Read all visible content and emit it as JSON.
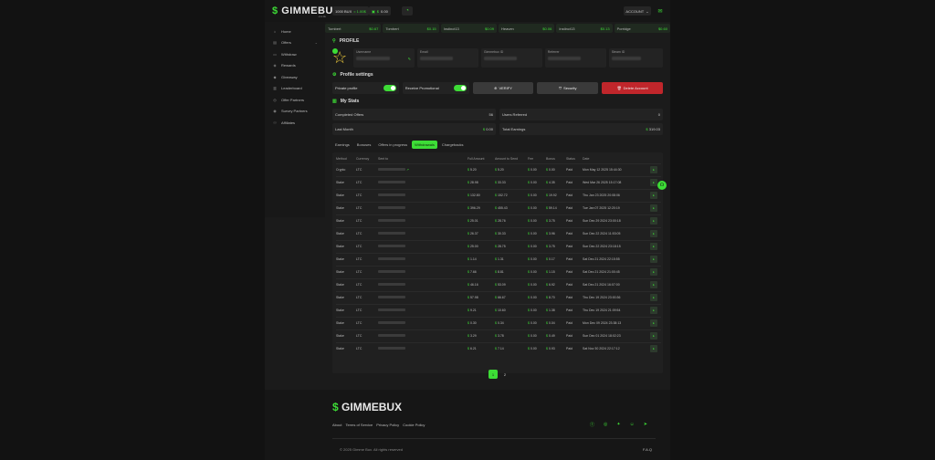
{
  "brand": {
    "name": "GIMMEBUX",
    "sub": ".com"
  },
  "topbar": {
    "balance_bux": "1000 BUX",
    "balance_eq": "= 1.00$",
    "wallet_amount": "0.00",
    "account_label": "ACCOUNT"
  },
  "ticker": [
    {
      "name": "Tombert",
      "value": "0.67"
    },
    {
      "name": "Tombert",
      "value": "0.15"
    },
    {
      "name": "Instinct13",
      "value": "0.09"
    },
    {
      "name": "Heaven",
      "value": "0.06"
    },
    {
      "name": "Instinct13",
      "value": "0.13"
    },
    {
      "name": "Porridge",
      "value": "0.60"
    }
  ],
  "sidebar": {
    "items": [
      {
        "label": "Home",
        "icon": "home-icon"
      },
      {
        "label": "Offers",
        "icon": "offers-icon"
      },
      {
        "label": "Withdraw",
        "icon": "withdraw-icon"
      },
      {
        "label": "Rewards",
        "icon": "rewards-icon"
      },
      {
        "label": "Giveaway",
        "icon": "giveaway-icon"
      },
      {
        "label": "Leaderboard",
        "icon": "leaderboard-icon"
      },
      {
        "label": "Offer Partners",
        "icon": "partners-icon"
      },
      {
        "label": "Survey Partners",
        "icon": "survey-icon"
      },
      {
        "label": "Affiliates",
        "icon": "affiliates-icon"
      }
    ]
  },
  "profile": {
    "title": "PROFILE",
    "fields": [
      {
        "label": "Username"
      },
      {
        "label": "Email"
      },
      {
        "label": "Gimmebux ID"
      },
      {
        "label": "Referrer"
      },
      {
        "label": "Steam ID"
      }
    ]
  },
  "settings": {
    "title": "Profile settings",
    "private_profile": "Private profile",
    "receive_promotional": "Receive Promotional",
    "verify": "VERIFY",
    "security": "Security",
    "delete": "Delete Account"
  },
  "stats": {
    "title": "My Stats",
    "completed_offers_label": "Completed Offers",
    "completed_offers_value": "56",
    "users_referred_label": "Users Referred",
    "users_referred_value": "0",
    "last_month_label": "Last Month",
    "last_month_value": "0.00",
    "total_earnings_label": "Total Earnings",
    "total_earnings_value": "319.03"
  },
  "tabs": [
    "Earnings",
    "Bonuses",
    "Offers in progress",
    "Withdrawals",
    "Chargebacks"
  ],
  "table": {
    "headers": [
      "Method",
      "Currency",
      "Sent to",
      "Full Amount",
      "Amount to Send",
      "Fee",
      "Bonus",
      "Status",
      "Date"
    ],
    "rows": [
      {
        "method": "Crypto",
        "currency": "LTC",
        "full": "5.20",
        "send": "5.20",
        "fee": "0.00",
        "bonus": "0.00",
        "status": "Paid",
        "date": "Mon May 12 2025 15:44:30"
      },
      {
        "method": "Stake",
        "currency": "LTC",
        "full": "28.98",
        "send": "33.33",
        "fee": "0.00",
        "bonus": "4.35",
        "status": "Paid",
        "date": "Wed Mar 26 2025 15:17:08"
      },
      {
        "method": "Stake",
        "currency": "LTC",
        "full": "132.80",
        "send": "152.72",
        "fee": "0.00",
        "bonus": "19.92",
        "status": "Paid",
        "date": "Thu Jan 23 2025 20:08:06"
      },
      {
        "method": "Stake",
        "currency": "LTC",
        "full": "396.29",
        "send": "455.43",
        "fee": "0.00",
        "bonus": "59.14",
        "status": "Paid",
        "date": "Tue Jan 07 2025 12:20:19"
      },
      {
        "method": "Stake",
        "currency": "LTC",
        "full": "25.01",
        "send": "28.76",
        "fee": "0.00",
        "bonus": "3.75",
        "status": "Paid",
        "date": "Sun Dec 29 2024 23:00:18"
      },
      {
        "method": "Stake",
        "currency": "LTC",
        "full": "26.37",
        "send": "30.33",
        "fee": "0.00",
        "bonus": "3.96",
        "status": "Paid",
        "date": "Sun Dec 22 2024 11:53:05"
      },
      {
        "method": "Stake",
        "currency": "LTC",
        "full": "25.00",
        "send": "28.75",
        "fee": "0.00",
        "bonus": "3.75",
        "status": "Paid",
        "date": "Sun Dec 22 2024 23:18:15"
      },
      {
        "method": "Stake",
        "currency": "LTC",
        "full": "1.14",
        "send": "1.31",
        "fee": "0.00",
        "bonus": "0.17",
        "status": "Paid",
        "date": "Sat Dec 21 2024 22:15:55"
      },
      {
        "method": "Stake",
        "currency": "LTC",
        "full": "7.66",
        "send": "8.81",
        "fee": "0.00",
        "bonus": "1.15",
        "status": "Paid",
        "date": "Sat Dec 21 2024 21:00:45"
      },
      {
        "method": "Stake",
        "currency": "LTC",
        "full": "46.16",
        "send": "53.09",
        "fee": "0.00",
        "bonus": "6.92",
        "status": "Paid",
        "date": "Sat Dec 21 2024 16:07:00"
      },
      {
        "method": "Stake",
        "currency": "LTC",
        "full": "57.98",
        "send": "66.67",
        "fee": "0.00",
        "bonus": "8.70",
        "status": "Paid",
        "date": "Thu Dec 19 2024 23:00:36"
      },
      {
        "method": "Stake",
        "currency": "LTC",
        "full": "9.21",
        "send": "10.60",
        "fee": "0.00",
        "bonus": "1.38",
        "status": "Paid",
        "date": "Thu Dec 19 2024 21:09:54"
      },
      {
        "method": "Stake",
        "currency": "LTC",
        "full": "0.30",
        "send": "0.34",
        "fee": "0.00",
        "bonus": "0.04",
        "status": "Paid",
        "date": "Mon Dec 09 2024 23:38:13"
      },
      {
        "method": "Stake",
        "currency": "LTC",
        "full": "3.29",
        "send": "3.78",
        "fee": "0.00",
        "bonus": "0.49",
        "status": "Paid",
        "date": "Sun Dec 01 2024 18:02:23"
      },
      {
        "method": "Stake",
        "currency": "LTC",
        "full": "6.21",
        "send": "7.14",
        "fee": "0.00",
        "bonus": "0.93",
        "status": "Paid",
        "date": "Sat Nov 30 2024 22:17:12"
      }
    ]
  },
  "pagination": [
    "1",
    "2"
  ],
  "footer": {
    "links": [
      "About",
      "Terms of Service",
      "Privacy Policy",
      "Cookie Policy"
    ],
    "copyright": "© 2025 Gimme Bux. All rights reserved",
    "faq": "F.A.Q"
  },
  "colors": {
    "accent": "#3ddc36",
    "danger": "#c0262b",
    "bg": "#121212"
  }
}
